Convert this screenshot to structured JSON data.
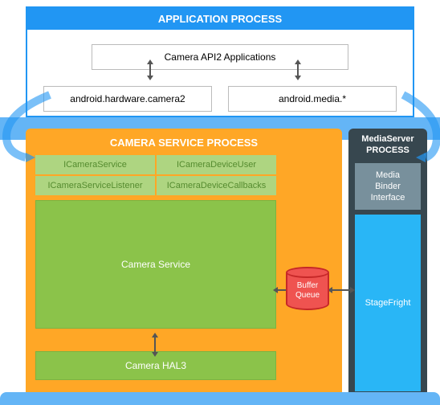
{
  "app_process": {
    "title": "APPLICATION PROCESS",
    "camera_apps": "Camera API2 Applications",
    "api_left": "android.hardware.camera2",
    "api_right": "android.media.*"
  },
  "camera_service_process": {
    "title": "CAMERA SERVICE PROCESS",
    "aidl": {
      "c1": "ICameraService",
      "c2": "ICameraDeviceUser",
      "c3": "ICameraServiceListener",
      "c4": "ICameraDeviceCallbacks"
    },
    "camera_service": "Camera Service",
    "camera_hal3": "Camera HAL3"
  },
  "mediaserver_process": {
    "title_line1": "MediaServer",
    "title_line2": "PROCESS",
    "media_binder_l1": "Media",
    "media_binder_l2": "Binder",
    "media_binder_l3": "Interface",
    "stagefright": "StageFright"
  },
  "buffer_queue": {
    "line1": "Buffer",
    "line2": "Queue"
  }
}
